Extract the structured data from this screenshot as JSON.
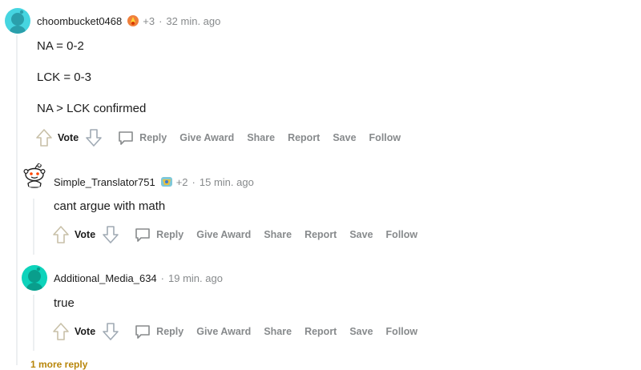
{
  "comments": [
    {
      "username": "choombucket0468",
      "award_count": "+3",
      "separator": "·",
      "time": "32 min. ago",
      "lines": [
        "NA = 0-2",
        "LCK = 0-3",
        "NA > LCK confirmed"
      ]
    },
    {
      "username": "Simple_Translator751",
      "award_count": "+2",
      "separator": "·",
      "time": "15 min. ago",
      "lines": [
        "cant argue with math"
      ]
    },
    {
      "username": "Additional_Media_634",
      "separator": "·",
      "time": "19 min. ago",
      "lines": [
        "true"
      ]
    }
  ],
  "actions": {
    "vote": "Vote",
    "reply": "Reply",
    "give_award": "Give Award",
    "share": "Share",
    "report": "Report",
    "save": "Save",
    "follow": "Follow"
  },
  "more_replies": "1 more reply",
  "colors": {
    "avatar_teal": "#46d5e0",
    "avatar_green": "#0dd3bb",
    "muted": "#878a8c",
    "thread_line": "#edeff1",
    "more_replies": "#b8860b"
  },
  "icons": [
    "snoo-avatar-icon",
    "upvote-icon",
    "downvote-icon",
    "reply-icon",
    "flair-icon"
  ]
}
